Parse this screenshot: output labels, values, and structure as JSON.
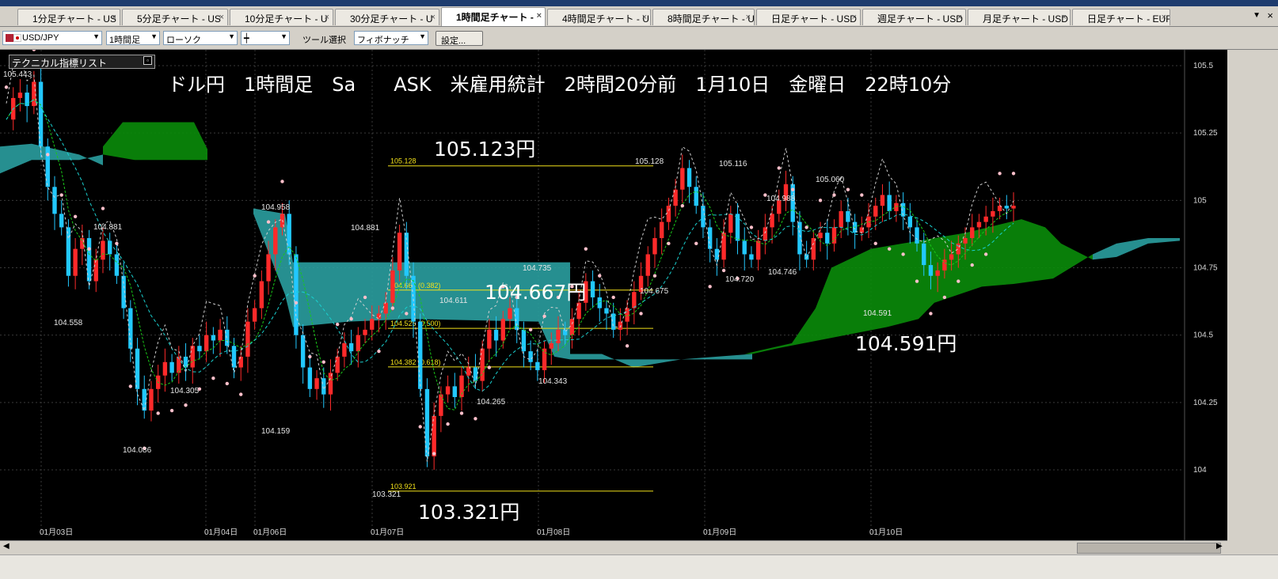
{
  "tabs": [
    {
      "label": "1分足チャート - US"
    },
    {
      "label": "5分足チャート - US"
    },
    {
      "label": "10分足チャート - U"
    },
    {
      "label": "30分足チャート - U"
    },
    {
      "label": "1時間足チャート -",
      "active": true
    },
    {
      "label": "4時間足チャート - U"
    },
    {
      "label": "8時間足チャート - U"
    },
    {
      "label": "日足チャート - USD"
    },
    {
      "label": "週足チャート - USD"
    },
    {
      "label": "月足チャート - USD"
    },
    {
      "label": "日足チャート - EUR"
    }
  ],
  "tab_close_glyph": "×",
  "tabbar_menu_glyph": "▼",
  "tabbar_close_glyph": "×",
  "toolbar": {
    "symbol": "USD/JPY",
    "timeframe": "1時間足",
    "chart_type": "ローソク",
    "line_style": "┿",
    "tool_label": "ツール選択",
    "tool_value": "フィボナッチ",
    "settings": "設定..."
  },
  "indicator_list": {
    "label": "テクニカル指標リスト"
  },
  "headline": "ドル円　1時間足　Sa　　ASK　米雇用統計　2時間20分前　1月10日　金曜日　22時10分",
  "annotations": {
    "high": "105.123円",
    "mid": "104.667円",
    "low": "103.321円",
    "cloud": "104.591円"
  },
  "colors": {
    "background": "#000000",
    "bull": "#ff2a2a",
    "bear": "#22c8ff",
    "cloud_up": "#0a8c0a",
    "cloud_down": "#2a9ea0",
    "sar": "#ffc0cb",
    "fib": "#f2e11a"
  },
  "chart_data": {
    "type": "candlestick",
    "pair": "USD/JPY",
    "timeframe": "1時間足",
    "y_axis": {
      "min": 104.0,
      "max": 105.5,
      "ticks": [
        105.5,
        105.25,
        105.0,
        104.75,
        104.5,
        104.25,
        104.0
      ]
    },
    "x_axis_labels": [
      "01月03日",
      "01月04日",
      "01月06日",
      "01月07日",
      "01月08日",
      "01月09日",
      "01月10日"
    ],
    "fibonacci": [
      {
        "label": "105.128",
        "value": 105.128
      },
      {
        "label": "104.667 (0.382)",
        "value": 104.667
      },
      {
        "label": "104.525 (0.500)",
        "value": 104.525
      },
      {
        "label": "104.382 (0.618)",
        "value": 104.382
      },
      {
        "label": "103.921",
        "value": 103.921
      }
    ],
    "price_labels": [
      {
        "text": "105.443"
      },
      {
        "text": "104.881"
      },
      {
        "text": "104.558"
      },
      {
        "text": "104.086"
      },
      {
        "text": "104.305"
      },
      {
        "text": "104.159"
      },
      {
        "text": "104.958"
      },
      {
        "text": "104.881"
      },
      {
        "text": "103.321"
      },
      {
        "text": "104.611"
      },
      {
        "text": "104.735"
      },
      {
        "text": "104.265"
      },
      {
        "text": "104.343"
      },
      {
        "text": "105.128"
      },
      {
        "text": "104.675"
      },
      {
        "text": "105.116"
      },
      {
        "text": "104.720"
      },
      {
        "text": "104.988"
      },
      {
        "text": "104.746"
      },
      {
        "text": "105.060"
      },
      {
        "text": "104.591"
      }
    ],
    "ohlc_approx": [
      {
        "t": "01月03日",
        "open": 105.3,
        "high": 105.443,
        "low": 104.55,
        "close": 104.7
      },
      {
        "t": "01月04日",
        "open": 104.35,
        "high": 104.6,
        "low": 104.25,
        "close": 104.5
      },
      {
        "t": "01月06日",
        "open": 104.9,
        "high": 104.958,
        "low": 104.2,
        "close": 104.35
      },
      {
        "t": "01月07日",
        "open": 104.8,
        "high": 104.881,
        "low": 103.921,
        "close": 104.3
      },
      {
        "t": "01月08日",
        "open": 104.4,
        "high": 105.128,
        "low": 104.265,
        "close": 105.0
      },
      {
        "t": "01月09日",
        "open": 105.0,
        "high": 105.116,
        "low": 104.72,
        "close": 104.85
      },
      {
        "t": "01月10日",
        "open": 104.9,
        "high": 105.06,
        "low": 104.591,
        "close": 104.95
      }
    ]
  }
}
